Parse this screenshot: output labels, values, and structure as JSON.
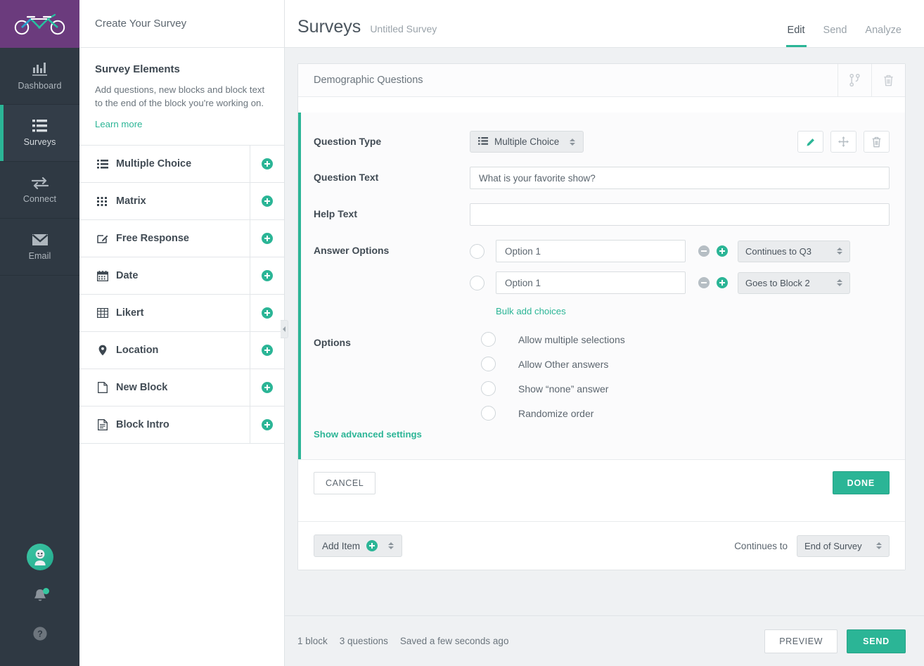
{
  "brand": {
    "logo_icon": "tandem-bicycle-logo",
    "purple": "#6b3b7d",
    "green": "#2bb596",
    "dark": "#2f3943"
  },
  "rail": {
    "items": [
      {
        "label": "Dashboard",
        "icon": "bar-chart-icon",
        "active": false
      },
      {
        "label": "Surveys",
        "icon": "list-icon",
        "active": true
      },
      {
        "label": "Connect",
        "icon": "exchange-arrows-icon",
        "active": false
      },
      {
        "label": "Email",
        "icon": "envelope-icon",
        "active": false
      }
    ],
    "bottom": {
      "avatar_icon": "user-avatar-icon",
      "bell_icon": "bell-icon",
      "bell_has_badge": true,
      "help_icon": "help-question-icon"
    }
  },
  "panel": {
    "header_title": "Create Your Survey",
    "intro_title": "Survey Elements",
    "intro_text": "Add questions, new blocks and block text to the end of the block you're working on.",
    "learn_more": "Learn more",
    "elements": [
      {
        "label": "Multiple Choice",
        "icon": "list-ol-icon",
        "add": "add-icon"
      },
      {
        "label": "Matrix",
        "icon": "grid-dots-icon",
        "add": "add-icon"
      },
      {
        "label": "Free Response",
        "icon": "pencil-square-icon",
        "add": "add-icon"
      },
      {
        "label": "Date",
        "icon": "calendar-icon",
        "add": "add-icon"
      },
      {
        "label": "Likert",
        "icon": "table-icon",
        "add": "add-icon"
      },
      {
        "label": "Location",
        "icon": "map-pin-icon",
        "add": "add-icon"
      },
      {
        "label": "New Block",
        "icon": "file-icon",
        "add": "add-icon"
      },
      {
        "label": "Block Intro",
        "icon": "file-text-icon",
        "add": "add-icon"
      }
    ]
  },
  "header": {
    "title": "Surveys",
    "subtitle": "Untitled Survey",
    "tabs": [
      {
        "label": "Edit",
        "active": true
      },
      {
        "label": "Send",
        "active": false
      },
      {
        "label": "Analyze",
        "active": false
      }
    ]
  },
  "block": {
    "title": "Demographic Questions",
    "logic_icon": "branch-logic-icon",
    "delete_icon": "trash-icon"
  },
  "question": {
    "type_label": "Question Type",
    "type_value": "Multiple Choice",
    "type_icon": "list-ol-icon",
    "actions": [
      {
        "name": "edit-question-button",
        "icon": "pencil-icon"
      },
      {
        "name": "move-question-button",
        "icon": "move-arrows-icon"
      },
      {
        "name": "delete-question-button",
        "icon": "trash-icon"
      }
    ],
    "text_label": "Question Text",
    "text_value": "What is your favorite show?",
    "help_label": "Help Text",
    "help_value": "",
    "help_placeholder": "",
    "answer_options_label": "Answer Options",
    "answer_options": [
      {
        "value": "Option 1",
        "logic": "Continues to Q3"
      },
      {
        "value": "Option 1",
        "logic": "Goes to Block 2"
      }
    ],
    "bulk_add": "Bulk add choices",
    "options_label": "Options",
    "options": [
      {
        "label": "Allow multiple selections",
        "checked": false
      },
      {
        "label": "Allow Other answers",
        "checked": false
      },
      {
        "label": "Show “none” answer",
        "checked": false
      },
      {
        "label": "Randomize order",
        "checked": false
      }
    ],
    "advanced_link": "Show advanced settings",
    "cancel_label": "CANCEL",
    "done_label": "DONE"
  },
  "block_footer": {
    "add_item_label": "Add Item",
    "continues_label": "Continues to",
    "continues_value": "End of Survey"
  },
  "status": {
    "blocks": "1 block",
    "questions": "3 questions",
    "saved": "Saved a few seconds ago",
    "preview_label": "PREVIEW",
    "send_label": "SEND"
  }
}
